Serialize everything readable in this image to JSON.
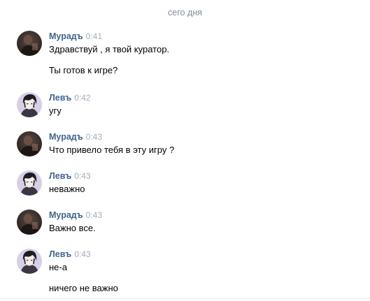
{
  "date_separator": "сего дня",
  "messages": [
    {
      "author": "Мурадъ",
      "time": "0:41",
      "avatar": "dark-portrait-icon",
      "lines": [
        "Здравствуй , я твой куратор.",
        "Ты готов к игре?"
      ]
    },
    {
      "author": "Левъ",
      "time": "0:42",
      "avatar": "anime-portrait-icon",
      "lines": [
        "угу"
      ]
    },
    {
      "author": "Мурадъ",
      "time": "0:43",
      "avatar": "dark-portrait-icon",
      "lines": [
        "Что привело тебя в эту игру ?"
      ]
    },
    {
      "author": "Левъ",
      "time": "0:43",
      "avatar": "anime-portrait-icon",
      "lines": [
        "неважно"
      ]
    },
    {
      "author": "Мурадъ",
      "time": "0:43",
      "avatar": "dark-portrait-icon",
      "lines": [
        "Важно все."
      ]
    },
    {
      "author": "Левъ",
      "time": "0:43",
      "avatar": "anime-portrait-icon",
      "lines": [
        "не-а",
        "ничего не важно"
      ]
    }
  ],
  "colors": {
    "author": "#42648b",
    "time": "#a3adba",
    "separator": "#7f8c9a",
    "text": "#000000"
  }
}
